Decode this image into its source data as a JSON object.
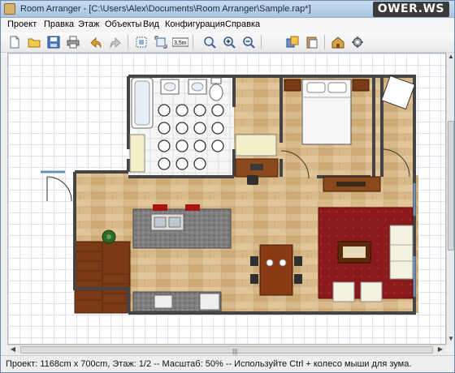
{
  "window": {
    "title": "Room Arranger - [C:\\Users\\Alex\\Documents\\Room Arranger\\Sample.rap*]",
    "watermark": "OWER.WS"
  },
  "menu": {
    "items": [
      "Проект",
      "Правка",
      "Этаж",
      "Объекты",
      "Вид",
      "Конфигурация",
      "Справка"
    ]
  },
  "toolbar": {
    "buttons": [
      "new-project-icon",
      "open-folder-icon",
      "save-icon",
      "print-icon",
      "undo-icon",
      "redo-icon",
      "fit-room-icon",
      "fit-selection-icon",
      "measure-3-5m-icon",
      "zoom-fit-icon",
      "zoom-in-icon",
      "zoom-out-icon",
      "copy-objects-icon",
      "paste-objects-icon",
      "view-3d-icon",
      "settings-icon"
    ],
    "measure_label": "3,5m"
  },
  "status": {
    "text": "Проект: 1168cm x 700cm, Этаж: 1/2 -- Масштаб: 50% -- Используйте Ctrl + колесо мыши для зума."
  },
  "colors": {
    "floor_wood": "#d8b98a",
    "tile_floor": "#ffffff",
    "rug": "#8a1a1a",
    "stair_wood": "#7a3a16",
    "counter": "#7d7d7d",
    "wall": "#444444",
    "grid": "#dde2ea",
    "window_bg": "#f0f0f0"
  }
}
